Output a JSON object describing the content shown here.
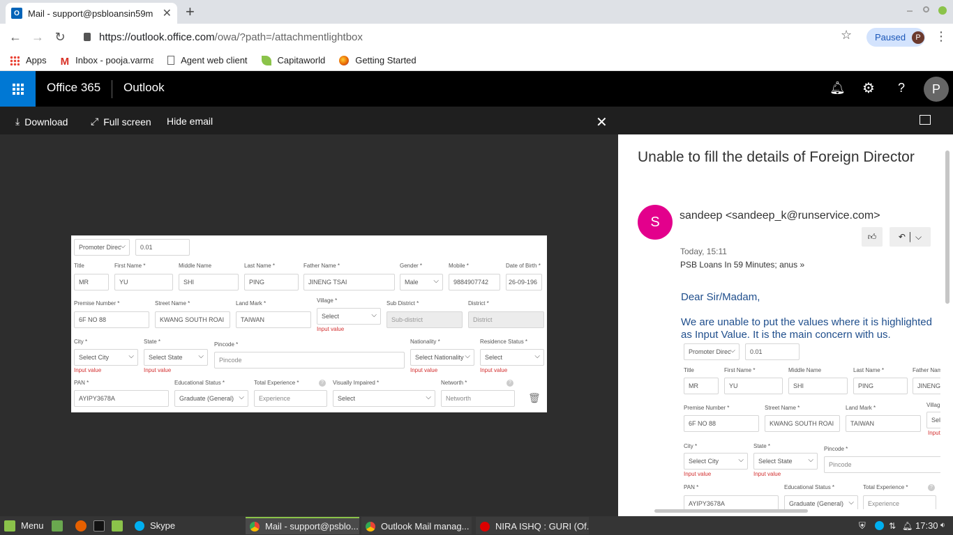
{
  "browser": {
    "tab_title": "Mail - support@psbloansin59m",
    "url_host": "https://outlook.office.com",
    "url_path": "/owa/?path=/attachmentlightbox",
    "paused_label": "Paused",
    "profile_initial": "P",
    "bookmarks": [
      "Apps",
      "Inbox - pooja.varma",
      "Agent web client",
      "Capitaworld",
      "Getting Started"
    ]
  },
  "o365": {
    "brand": "Office 365",
    "app": "Outlook",
    "avatar_initial": "P"
  },
  "lightbox": {
    "download": "Download",
    "fullscreen": "Full screen",
    "hide_email": "Hide email"
  },
  "form": {
    "promoter": "Promoter Direc",
    "share": "0.01",
    "labels": {
      "title": "Title",
      "first_name": "First Name *",
      "middle_name": "Middle Name",
      "last_name": "Last Name *",
      "father_name": "Father Name *",
      "gender": "Gender *",
      "mobile": "Mobile *",
      "dob": "Date of Birth *",
      "premise": "Premise Number *",
      "street": "Street Name *",
      "landmark": "Land Mark *",
      "village": "Village *",
      "subdistrict": "Sub District *",
      "district": "District *",
      "city": "City *",
      "state": "State *",
      "pincode": "Pincode *",
      "nationality": "Nationality *",
      "residence": "Residence Status *",
      "pan": "PAN *",
      "education": "Educational Status *",
      "experience": "Total Experience *",
      "visually": "Visually Impaired *",
      "networth": "Networth *"
    },
    "values": {
      "title": "MR",
      "first_name": "YU",
      "middle_name": "SHI",
      "last_name": "PING",
      "father_name": "JINENG TSAI",
      "gender": "Male",
      "mobile": "9884907742",
      "dob": "26-09-196",
      "premise": "6F NO 88",
      "street": "KWANG SOUTH ROAI",
      "landmark": "TAIWAN",
      "village": "Select",
      "subdistrict": "Sub-district",
      "district": "District",
      "city": "Select City",
      "state": "Select State",
      "pincode": "Pincode",
      "nationality": "Select Nationality",
      "residence": "Select",
      "pan": "AYIPY3678A",
      "education": "Graduate (General)",
      "experience": "Experience",
      "visually": "Select",
      "networth": "Networth"
    },
    "error": "Input value",
    "help": "?"
  },
  "email": {
    "subject": "Unable to fill the details of Foreign Director",
    "avatar": "S",
    "sender": "sandeep <sandeep_k@runservice.com>",
    "time": "Today, 15:11",
    "to": "PSB Loans In 59 Minutes; anus",
    "greeting": "Dear Sir/Madam,",
    "body": "We are unable to put the values  where it is highlighted as Input Value. It is the main concern with us."
  },
  "inline_form": {
    "promoter": "Promoter Direc",
    "share": "0.01",
    "labels": {
      "title": "Title",
      "first_name": "First Name *",
      "middle_name": "Middle Name",
      "last_name": "Last Name *",
      "father_name": "Father Nam",
      "premise": "Premise Number *",
      "street": "Street Name *",
      "landmark": "Land Mark *",
      "village": "Villag",
      "city": "City *",
      "state": "State *",
      "pincode": "Pincode *",
      "pan": "PAN *",
      "education": "Educational Status *",
      "experience": "Total Experience *"
    },
    "values": {
      "title": "MR",
      "first_name": "YU",
      "middle_name": "SHI",
      "last_name": "PING",
      "father_name": "JINENG",
      "premise": "6F NO 88",
      "street": "KWANG SOUTH ROAI",
      "landmark": "TAIWAN",
      "village": "Sele",
      "city": "Select City",
      "state": "Select State",
      "pincode": "Pincode",
      "pan": "AYIPY3678A",
      "education": "Graduate (General)",
      "experience": "Experience"
    },
    "error": "Input value",
    "village_err": "Input",
    "help": "?"
  },
  "taskbar": {
    "menu": "Menu",
    "skype": "Skype",
    "windows": [
      "Mail - support@psblo...",
      "Outlook Mail manag...",
      "NIRA ISHQ : GURI (Of..."
    ],
    "clock": "17:30"
  }
}
